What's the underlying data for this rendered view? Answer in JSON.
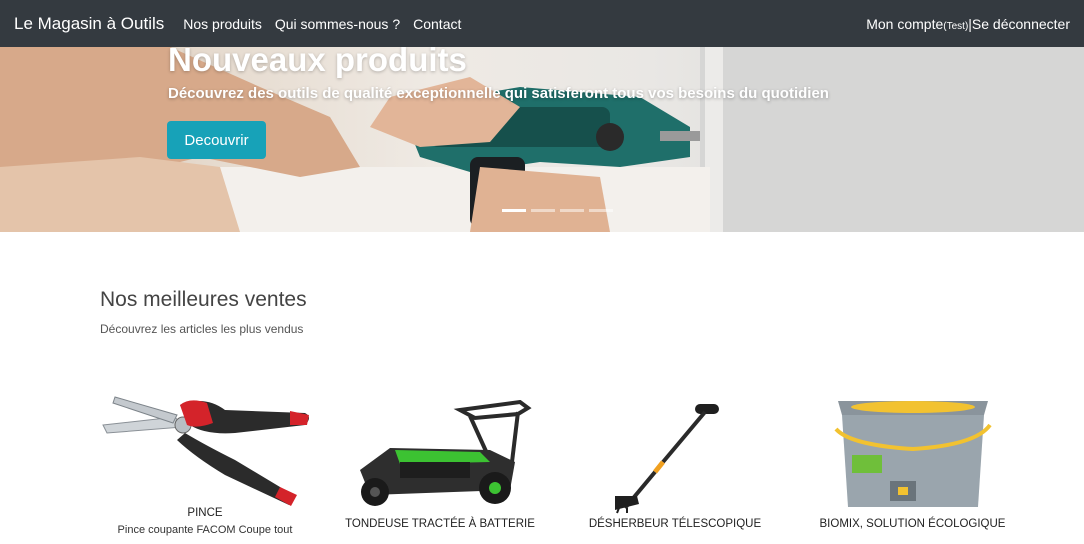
{
  "navbar": {
    "brand": "Le Magasin à Outils",
    "links": [
      "Nos produits",
      "Qui sommes-nous ?",
      "Contact"
    ],
    "account_label": "Mon compte",
    "account_user": "(Test)",
    "logout_label": " |Se déconnecter"
  },
  "hero": {
    "title": "Nouveaux produits",
    "subtitle": "Découvrez des outils de qualité exceptionnelle qui satisferont tous vos besoins du quotidien",
    "button_label": "Decouvrir",
    "slides_count": 4,
    "active_slide": 1
  },
  "bestsellers": {
    "title": "Nos meilleures ventes",
    "subtitle": "Découvrez les articles les plus vendus",
    "products": [
      {
        "name": "PINCE",
        "description": "Pince coupante FACOM Coupe tout",
        "icon": "pruning-shears-image"
      },
      {
        "name": "TONDEUSE TRACTÉE À BATTERIE",
        "description": "",
        "icon": "lawn-mower-image"
      },
      {
        "name": "DÉSHERBEUR TÉLESCOPIQUE",
        "description": "",
        "icon": "weeder-image"
      },
      {
        "name": "BIOMIX, SOLUTION ÉCOLOGIQUE",
        "description": "",
        "icon": "biomix-bucket-image"
      }
    ]
  },
  "colors": {
    "navbar_bg": "#343a40",
    "button_bg": "#17a2b8",
    "mower_green": "#3cc232",
    "bucket_yellow": "#f2c230"
  }
}
